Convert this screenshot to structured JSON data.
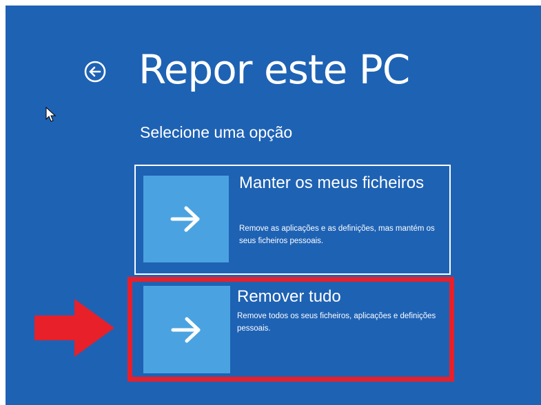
{
  "page": {
    "title": "Repor este PC",
    "subtitle": "Selecione uma opção",
    "back_icon": "back-arrow-circle-icon"
  },
  "options": [
    {
      "title": "Manter os meus ficheiros",
      "description": "Remove as aplicações e as definições, mas mantém os seus ficheiros pessoais.",
      "icon": "arrow-right-icon",
      "selected_outline": true
    },
    {
      "title": "Remover tudo",
      "description": "Remove todos os seus ficheiros, aplicações e definições pessoais.",
      "icon": "arrow-right-icon",
      "annotated": true
    }
  ],
  "annotation": {
    "arrow_icon": "red-pointer-arrow-icon",
    "color": "#e8202a"
  },
  "colors": {
    "background": "#1e62b4",
    "tile": "#4aa3e0",
    "text": "#ffffff",
    "highlight": "#e8202a"
  }
}
